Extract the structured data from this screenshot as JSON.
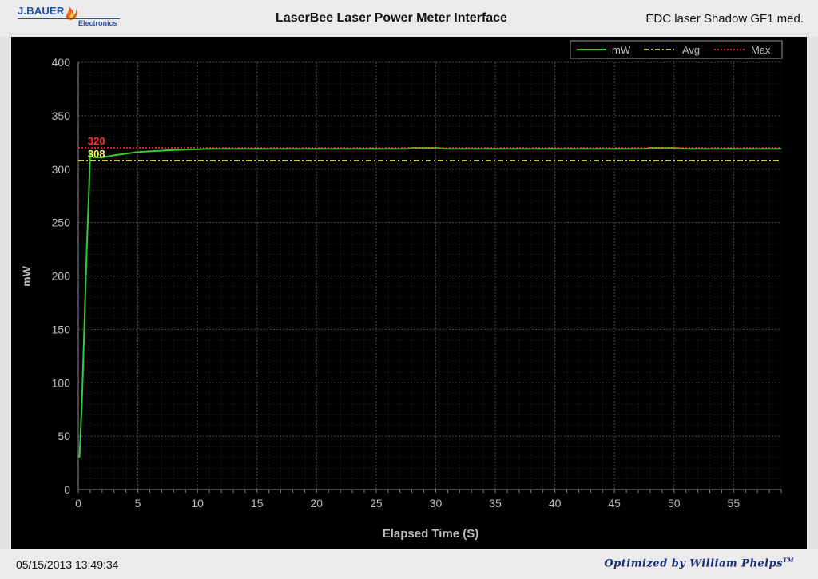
{
  "header": {
    "logo_top": "J.BAUER",
    "logo_bottom": "Electronics",
    "title": "LaserBee Laser Power Meter Interface",
    "subtitle": "EDC laser Shadow GF1 med."
  },
  "footer": {
    "timestamp": "05/15/2013 13:49:34",
    "credit": "Optimized by William Phelps",
    "credit_mark": "TM"
  },
  "colors": {
    "plot_bg": "#000000",
    "grid": "#4a4a4a",
    "axis_text": "#bdbdbd",
    "mw": "#33cc33",
    "avg": "#ffff66",
    "max": "#ff3333"
  },
  "chart_data": {
    "type": "line",
    "xlabel": "Elapsed Time (S)",
    "ylabel": "mW",
    "xlim": [
      0,
      59
    ],
    "ylim": [
      0,
      400
    ],
    "x_ticks": [
      0,
      5,
      10,
      15,
      20,
      25,
      30,
      35,
      40,
      45,
      50,
      55
    ],
    "y_ticks": [
      0,
      50,
      100,
      150,
      200,
      250,
      300,
      350,
      400
    ],
    "grid": true,
    "legend_position": "top-right",
    "legend": [
      "mW",
      "Avg",
      "Max"
    ],
    "series": [
      {
        "name": "mW",
        "style": "solid",
        "color": "#33cc33",
        "x": [
          0.1,
          0.3,
          0.5,
          0.7,
          0.9,
          1.0,
          1.3,
          2,
          3,
          5,
          8,
          11,
          15,
          20,
          25,
          27.5,
          28,
          30,
          31,
          35,
          40,
          45,
          47.5,
          48,
          50,
          51,
          55,
          59
        ],
        "y": [
          30,
          80,
          150,
          220,
          280,
          315,
          311,
          311,
          313,
          316,
          318,
          319,
          319,
          319,
          319,
          319,
          320,
          320,
          319,
          319,
          319,
          319,
          319,
          320,
          320,
          319,
          319,
          319
        ]
      },
      {
        "name": "Avg",
        "style": "dash-dot",
        "color": "#ffff66",
        "x": [
          0,
          59
        ],
        "y": [
          308,
          308
        ]
      },
      {
        "name": "Max",
        "style": "dotted",
        "color": "#ff3333",
        "x": [
          0,
          59
        ],
        "y": [
          320,
          320
        ]
      }
    ],
    "annotations": [
      {
        "text": "320",
        "x": 0.8,
        "y": 320,
        "color": "#ff3333"
      },
      {
        "text": "308",
        "x": 0.8,
        "y": 308,
        "color": "#ffff66"
      }
    ]
  }
}
